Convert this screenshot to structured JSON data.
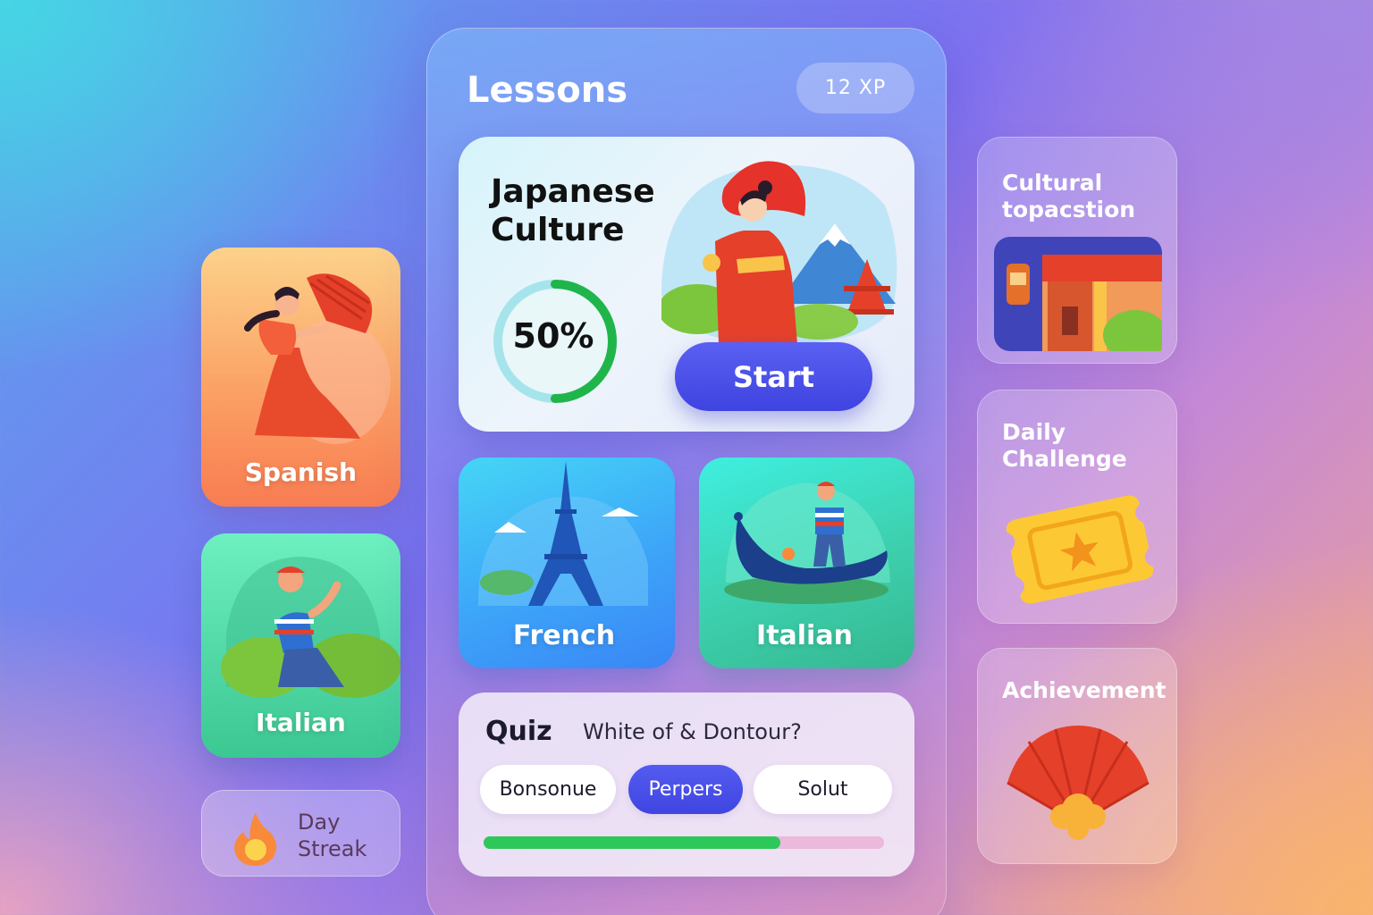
{
  "header": {
    "title": "Lessons",
    "xp": "12 XP"
  },
  "featured": {
    "title": "Japanese Culture",
    "progress_label": "50%",
    "progress": 0.5,
    "start_label": "Start"
  },
  "left_cards": {
    "spanish": "Spanish",
    "italian": "Italian",
    "streak": "Day Streak"
  },
  "mid_cards": {
    "french": "French",
    "italian": "Italian"
  },
  "quiz": {
    "title": "Quiz",
    "question": "White of & Dontour?",
    "options": [
      "Bonsonue",
      "Perpers",
      "Solut"
    ],
    "selected": "Perpers",
    "progress": 0.74
  },
  "right_cards": {
    "cultural": "Cultural topacstion",
    "daily": "Daily Challenge",
    "achievement": "Achievement"
  },
  "colors": {
    "accent": "#4147e4",
    "progress_green": "#2ec85a",
    "spanish": "#f98e5a",
    "italian": "#4fd6a4",
    "french": "#3da6f8"
  }
}
